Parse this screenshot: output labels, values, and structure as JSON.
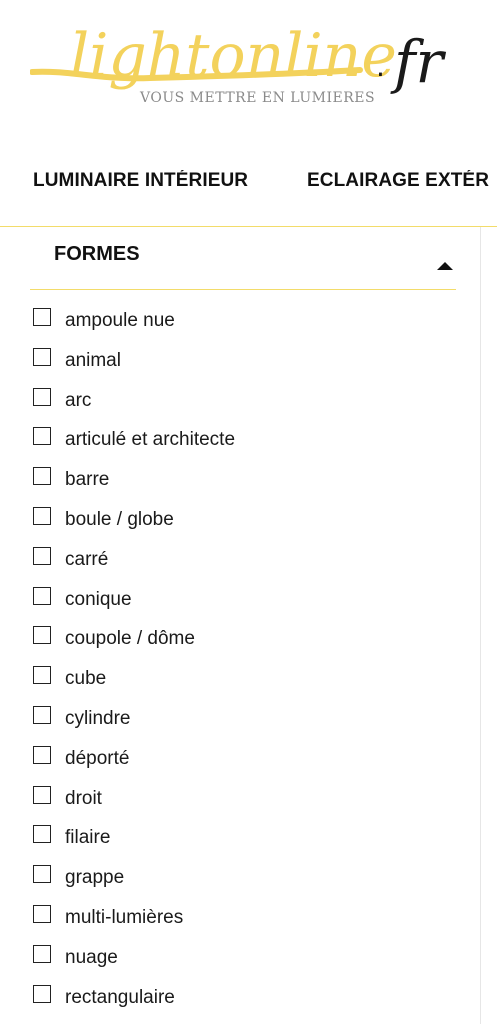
{
  "logo": {
    "brand": "lightonline",
    "dot": ".",
    "tld": "fr",
    "tagline": "VOUS METTRE EN LUMIERES",
    "brand_color": "#f3d25c"
  },
  "nav": {
    "items": [
      {
        "label": "LUMINAIRE INTÉRIEUR"
      },
      {
        "label": "ECLAIRAGE EXTÉR"
      }
    ]
  },
  "filter": {
    "title": "FORMES",
    "expanded": true,
    "options": [
      {
        "label": "ampoule nue",
        "checked": false
      },
      {
        "label": "animal",
        "checked": false
      },
      {
        "label": "arc",
        "checked": false
      },
      {
        "label": "articulé et architecte",
        "checked": false
      },
      {
        "label": "barre",
        "checked": false
      },
      {
        "label": "boule / globe",
        "checked": false
      },
      {
        "label": "carré",
        "checked": false
      },
      {
        "label": "conique",
        "checked": false
      },
      {
        "label": "coupole / dôme",
        "checked": false
      },
      {
        "label": "cube",
        "checked": false
      },
      {
        "label": "cylindre",
        "checked": false
      },
      {
        "label": "déporté",
        "checked": false
      },
      {
        "label": "droit",
        "checked": false
      },
      {
        "label": "filaire",
        "checked": false
      },
      {
        "label": "grappe",
        "checked": false
      },
      {
        "label": "multi-lumières",
        "checked": false
      },
      {
        "label": "nuage",
        "checked": false
      },
      {
        "label": "rectangulaire",
        "checked": false
      }
    ]
  }
}
